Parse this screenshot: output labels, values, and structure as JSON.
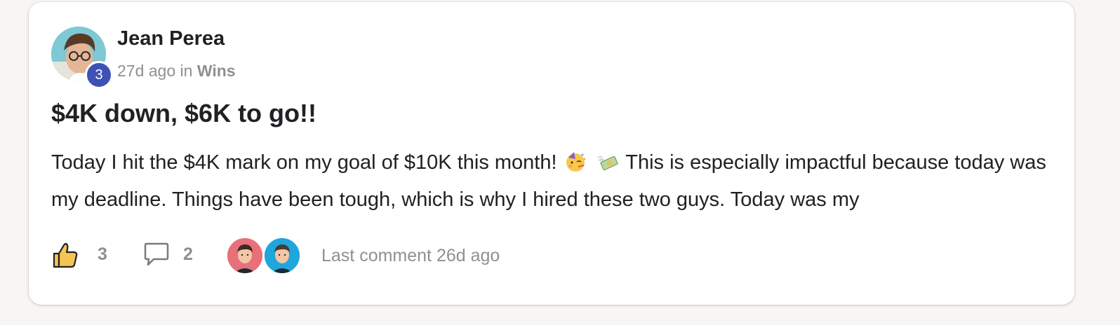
{
  "post": {
    "author": {
      "name": "Jean Perea",
      "level": "3"
    },
    "meta": {
      "time": "27d ago",
      "in_word": "in",
      "category": "Wins"
    },
    "title": "$4K down, $6K to go!!",
    "body": {
      "part1": "Today I hit the $4K mark on my goal of $10K this month!",
      "emoji1": "partying-face-emoji",
      "emoji2": "money-with-wings-emoji",
      "part2": "This is especially impactful because today was my deadline. Things have been tough, which is why I hired these two guys. Today was my"
    },
    "footer": {
      "likes": "3",
      "comments": "2",
      "last_comment": "Last comment 26d ago"
    }
  },
  "colors": {
    "level_badge": "#3f51b5",
    "muted_text": "#909090",
    "like_icon_fill": "#f6c453",
    "commenter1_bg": "#e8707a",
    "commenter2_bg": "#1fa6dc"
  }
}
